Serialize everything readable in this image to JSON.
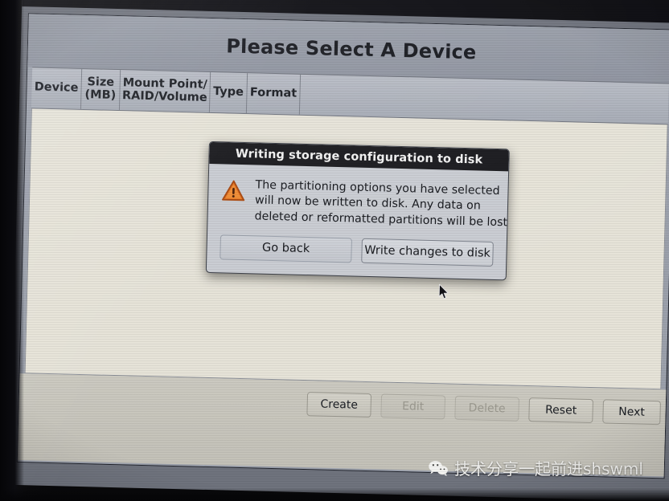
{
  "screen": {
    "page_title": "Please Select A Device"
  },
  "table": {
    "columns": [
      {
        "label": "Device",
        "key": "device"
      },
      {
        "label": "Size\n(MB)",
        "key": "size"
      },
      {
        "label": "Mount Point/\nRAID/Volume",
        "key": "mount"
      },
      {
        "label": "Type",
        "key": "type"
      },
      {
        "label": "Format",
        "key": "format"
      }
    ],
    "rows": []
  },
  "footer": {
    "buttons": [
      {
        "label": "Create",
        "enabled": true
      },
      {
        "label": "Edit",
        "enabled": false
      },
      {
        "label": "Delete",
        "enabled": false
      },
      {
        "label": "Reset",
        "enabled": true
      },
      {
        "label": "Next",
        "enabled": true
      }
    ]
  },
  "dialog": {
    "title": "Writing storage configuration to disk",
    "icon": "warning-triangle-icon",
    "message_lines": [
      "The partitioning options you have selected",
      "will now be written to disk.  Any data on",
      "deleted or reformatted partitions will be lost."
    ],
    "buttons": [
      {
        "label": "Go back",
        "hovered": false
      },
      {
        "label": "Write changes to disk",
        "hovered": true
      }
    ]
  },
  "watermark": {
    "icon": "wechat-icon",
    "text": "技术分享一起前进shswml"
  },
  "colors": {
    "warning_orange": "#e2701c",
    "dialog_titlebar": "#18181c",
    "panel_cream": "#e6e3d8",
    "window_grey": "#9ba0ab"
  }
}
